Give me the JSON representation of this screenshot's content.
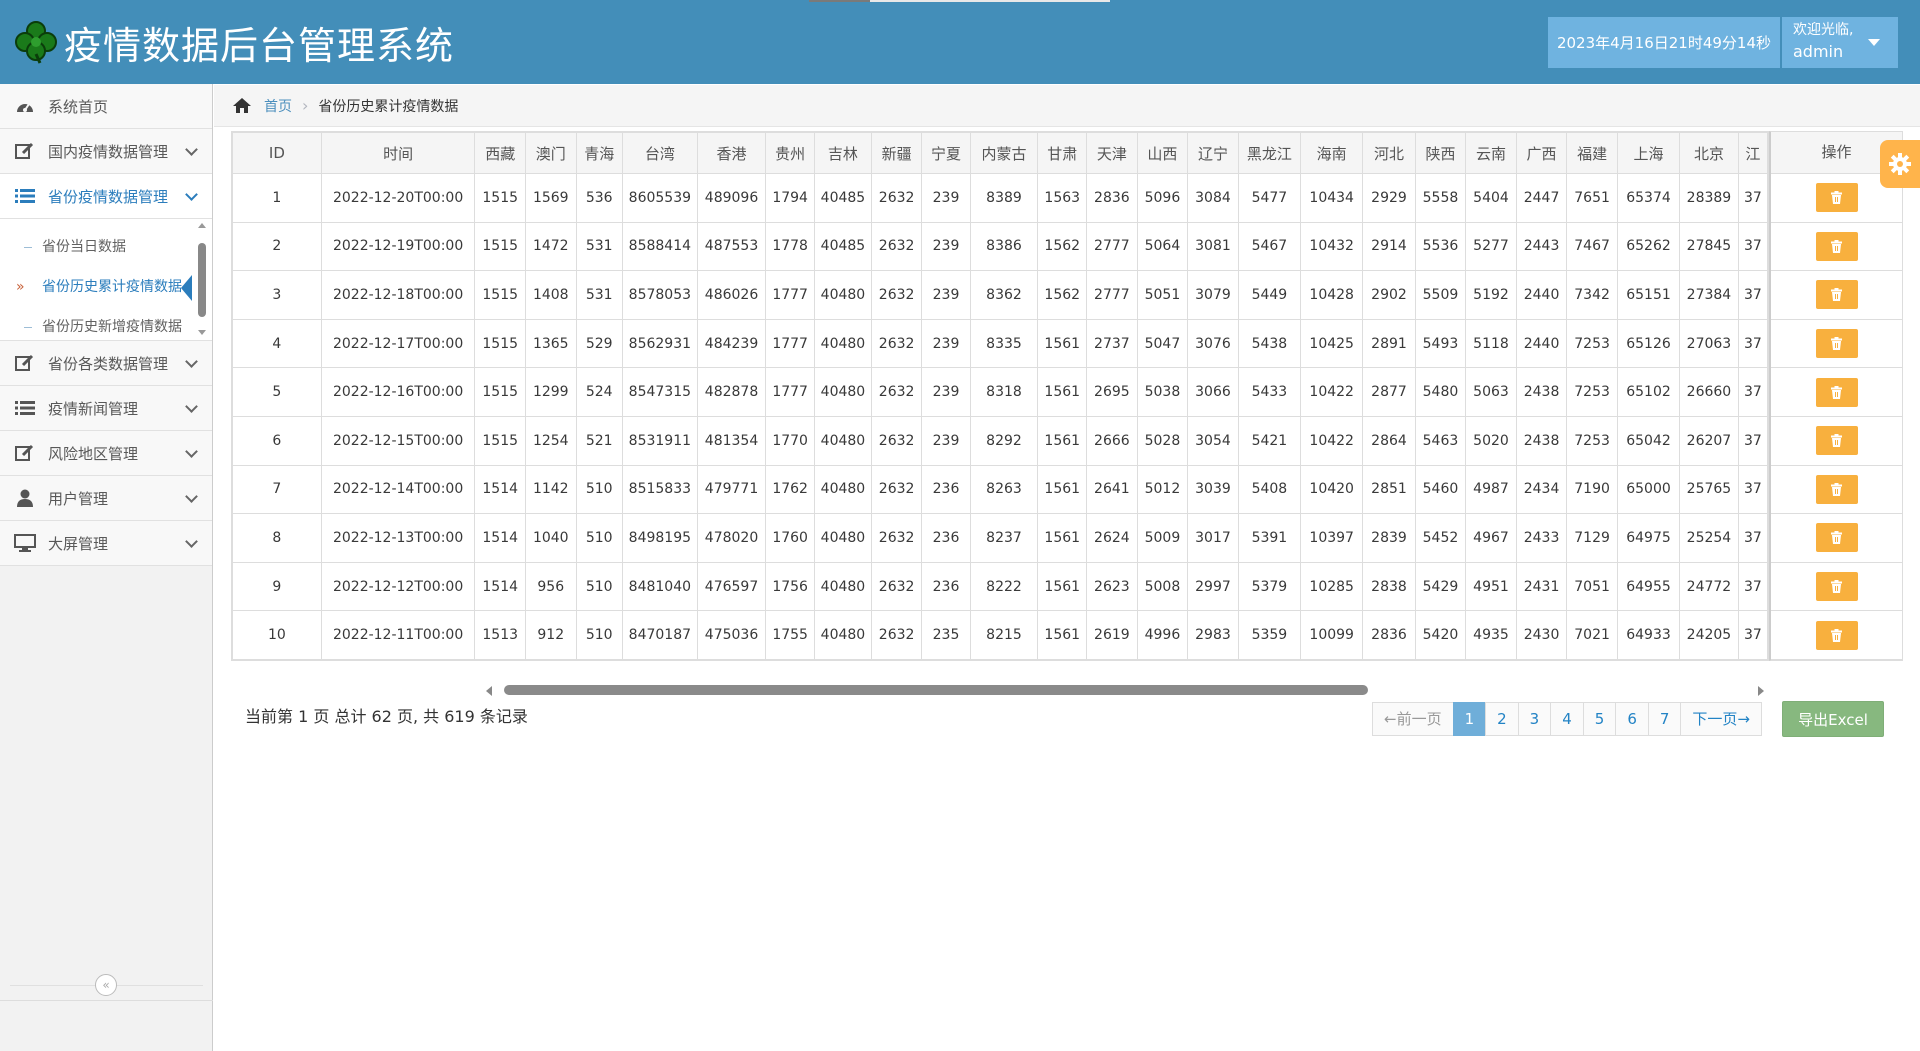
{
  "app": {
    "title": "疫情数据后台管理系统",
    "datetime": "2023年4月16日21时49分14秒",
    "welcome": "欢迎光临,",
    "username": "admin"
  },
  "sidebar": {
    "items": [
      {
        "label": "系统首页",
        "icon": "dashboard-icon"
      },
      {
        "label": "国内疫情数据管理",
        "icon": "edit-icon"
      },
      {
        "label": "省份疫情数据管理",
        "icon": "list-icon"
      },
      {
        "label": "省份各类数据管理",
        "icon": "edit-icon"
      },
      {
        "label": "疫情新闻管理",
        "icon": "list-icon"
      },
      {
        "label": "风险地区管理",
        "icon": "edit-icon"
      },
      {
        "label": "用户管理",
        "icon": "user-icon"
      },
      {
        "label": "大屏管理",
        "icon": "desktop-icon"
      }
    ],
    "submenu": [
      {
        "label": "省份当日数据"
      },
      {
        "label": "省份历史累计疫情数据"
      },
      {
        "label": "省份历史新增疫情数据"
      }
    ]
  },
  "breadcrumb": {
    "home": "首页",
    "current": "省份历史累计疫情数据"
  },
  "table": {
    "columns": [
      "ID",
      "时间",
      "西藏",
      "澳门",
      "青海",
      "台湾",
      "香港",
      "贵州",
      "吉林",
      "新疆",
      "宁夏",
      "内蒙古",
      "甘肃",
      "天津",
      "山西",
      "辽宁",
      "黑龙江",
      "海南",
      "河北",
      "陕西",
      "云南",
      "广西",
      "福建",
      "上海",
      "北京",
      "江"
    ],
    "action_header": "操作",
    "rows": [
      [
        "1",
        "2022-12-20T00:00",
        "1515",
        "1569",
        "536",
        "8605539",
        "489096",
        "1794",
        "40485",
        "2632",
        "239",
        "8389",
        "1563",
        "2836",
        "5096",
        "3084",
        "5477",
        "10434",
        "2929",
        "5558",
        "5404",
        "2447",
        "7651",
        "65374",
        "28389",
        "37"
      ],
      [
        "2",
        "2022-12-19T00:00",
        "1515",
        "1472",
        "531",
        "8588414",
        "487553",
        "1778",
        "40485",
        "2632",
        "239",
        "8386",
        "1562",
        "2777",
        "5064",
        "3081",
        "5467",
        "10432",
        "2914",
        "5536",
        "5277",
        "2443",
        "7467",
        "65262",
        "27845",
        "37"
      ],
      [
        "3",
        "2022-12-18T00:00",
        "1515",
        "1408",
        "531",
        "8578053",
        "486026",
        "1777",
        "40480",
        "2632",
        "239",
        "8362",
        "1562",
        "2777",
        "5051",
        "3079",
        "5449",
        "10428",
        "2902",
        "5509",
        "5192",
        "2440",
        "7342",
        "65151",
        "27384",
        "37"
      ],
      [
        "4",
        "2022-12-17T00:00",
        "1515",
        "1365",
        "529",
        "8562931",
        "484239",
        "1777",
        "40480",
        "2632",
        "239",
        "8335",
        "1561",
        "2737",
        "5047",
        "3076",
        "5438",
        "10425",
        "2891",
        "5493",
        "5118",
        "2440",
        "7253",
        "65126",
        "27063",
        "37"
      ],
      [
        "5",
        "2022-12-16T00:00",
        "1515",
        "1299",
        "524",
        "8547315",
        "482878",
        "1777",
        "40480",
        "2632",
        "239",
        "8318",
        "1561",
        "2695",
        "5038",
        "3066",
        "5433",
        "10422",
        "2877",
        "5480",
        "5063",
        "2438",
        "7253",
        "65102",
        "26660",
        "37"
      ],
      [
        "6",
        "2022-12-15T00:00",
        "1515",
        "1254",
        "521",
        "8531911",
        "481354",
        "1770",
        "40480",
        "2632",
        "239",
        "8292",
        "1561",
        "2666",
        "5028",
        "3054",
        "5421",
        "10422",
        "2864",
        "5463",
        "5020",
        "2438",
        "7253",
        "65042",
        "26207",
        "37"
      ],
      [
        "7",
        "2022-12-14T00:00",
        "1514",
        "1142",
        "510",
        "8515833",
        "479771",
        "1762",
        "40480",
        "2632",
        "236",
        "8263",
        "1561",
        "2641",
        "5012",
        "3039",
        "5408",
        "10420",
        "2851",
        "5460",
        "4987",
        "2434",
        "7190",
        "65000",
        "25765",
        "37"
      ],
      [
        "8",
        "2022-12-13T00:00",
        "1514",
        "1040",
        "510",
        "8498195",
        "478020",
        "1760",
        "40480",
        "2632",
        "236",
        "8237",
        "1561",
        "2624",
        "5009",
        "3017",
        "5391",
        "10397",
        "2839",
        "5452",
        "4967",
        "2433",
        "7129",
        "64975",
        "25254",
        "37"
      ],
      [
        "9",
        "2022-12-12T00:00",
        "1514",
        "956",
        "510",
        "8481040",
        "476597",
        "1756",
        "40480",
        "2632",
        "236",
        "8222",
        "1561",
        "2623",
        "5008",
        "2997",
        "5379",
        "10285",
        "2838",
        "5429",
        "4951",
        "2431",
        "7051",
        "64955",
        "24772",
        "37"
      ],
      [
        "10",
        "2022-12-11T00:00",
        "1513",
        "912",
        "510",
        "8470187",
        "475036",
        "1755",
        "40480",
        "2632",
        "235",
        "8215",
        "1561",
        "2619",
        "4996",
        "2983",
        "5359",
        "10099",
        "2836",
        "5420",
        "4935",
        "2430",
        "7021",
        "64933",
        "24205",
        "37"
      ]
    ]
  },
  "pagination": {
    "info": "当前第 1 页 总计 62 页, 共 619 条记录",
    "prev": "←前一页",
    "pages": [
      "1",
      "2",
      "3",
      "4",
      "5",
      "6",
      "7"
    ],
    "current_page": "1",
    "next": "下一页→"
  },
  "export_label": "导出Excel",
  "colors": {
    "header_bg": "#438eb9",
    "accent_blue": "#2b7dbc",
    "delete_orange": "#f8b03e",
    "export_green": "#87b87f"
  }
}
